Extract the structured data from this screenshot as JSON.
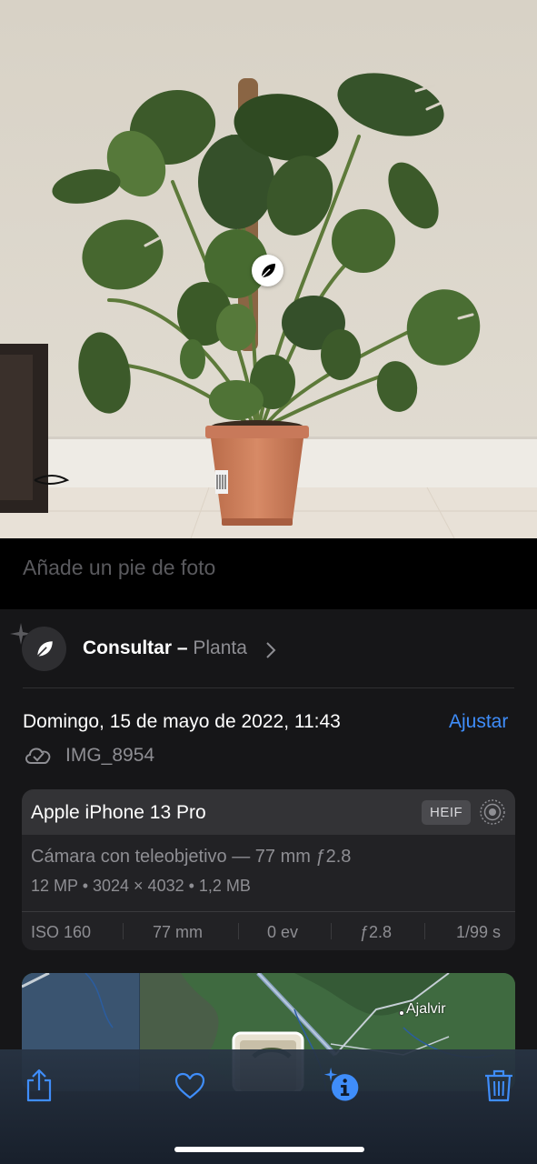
{
  "caption": {
    "placeholder": "Añade un pie de foto"
  },
  "visual_lookup": {
    "title": "Consultar –",
    "subject": "Planta"
  },
  "metadata": {
    "date": "Domingo, 15 de mayo de 2022, 11:43",
    "adjust_label": "Ajustar",
    "filename": "IMG_8954"
  },
  "camera": {
    "device": "Apple iPhone 13 Pro",
    "format_badge": "HEIF",
    "lens": "Cámara con teleobjetivo — 77 mm ƒ2.8",
    "specs": "12 MP  •  3024 × 4032  •  1,2 MB",
    "exif": {
      "iso": "ISO 160",
      "focal": "77 mm",
      "ev": "0 ev",
      "aperture": "ƒ2.8",
      "shutter": "1/99 s"
    }
  },
  "map": {
    "place_label": "Ajalvir"
  },
  "toolbar": {
    "share": "share-icon",
    "favorite": "heart-icon",
    "info": "info-sparkle-icon",
    "delete": "trash-icon"
  },
  "colors": {
    "accent": "#3f8dfa",
    "panel": "#161618",
    "card": "#222225"
  }
}
